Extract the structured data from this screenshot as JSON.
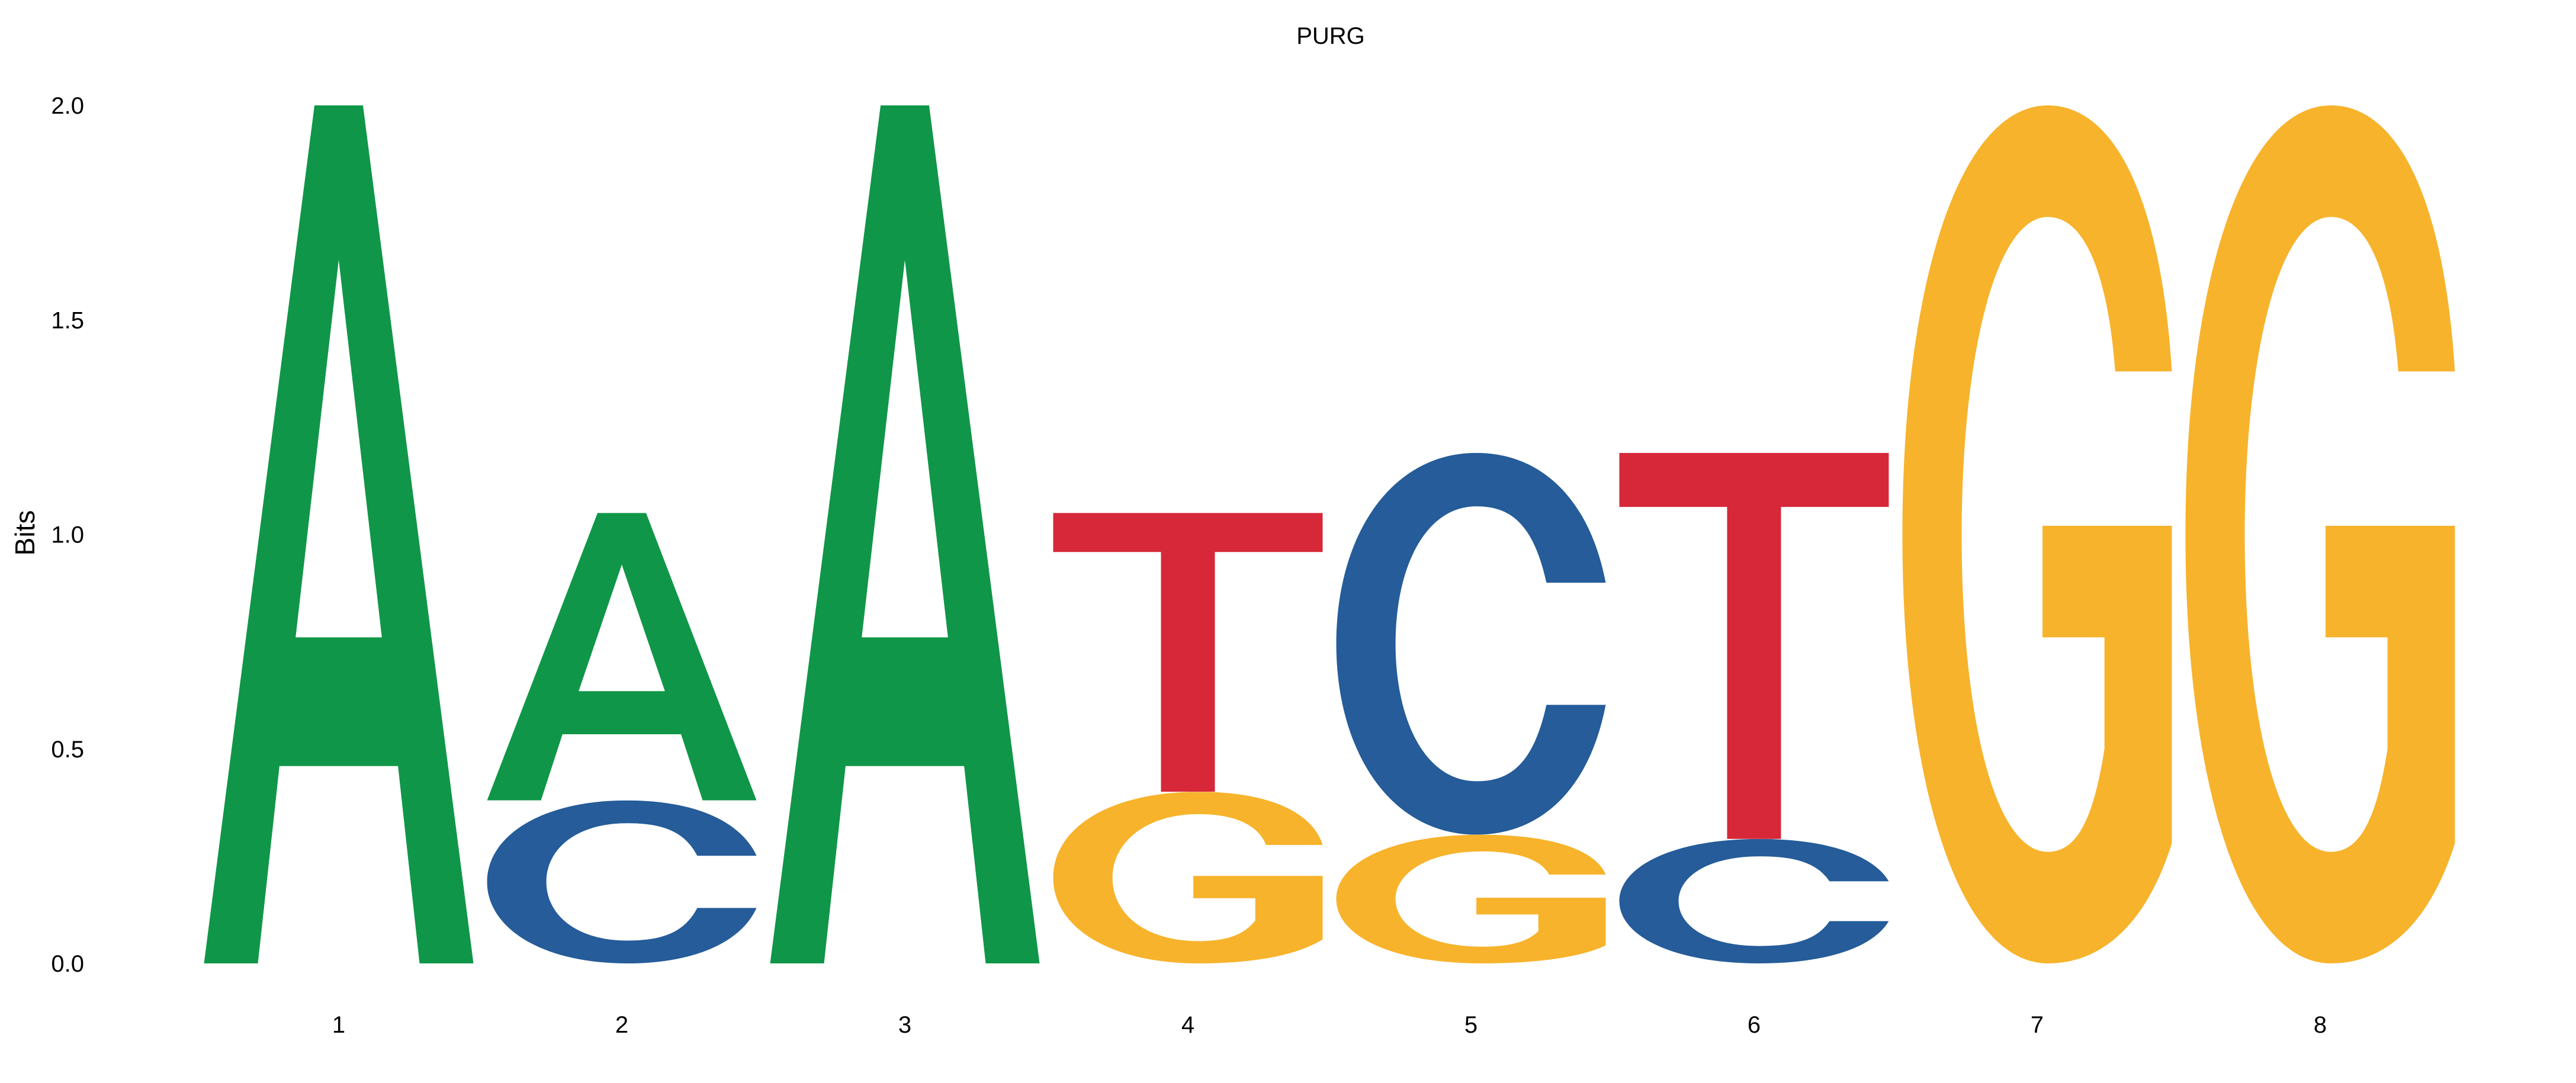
{
  "chart_data": {
    "type": "sequence-logo",
    "title": "PURG",
    "ylabel": "Bits",
    "xlabel": "",
    "ylim": [
      0,
      2.0
    ],
    "yticks": [
      "0.0",
      "0.5",
      "1.0",
      "1.5",
      "2.0"
    ],
    "ytick_values": [
      0.0,
      0.5,
      1.0,
      1.5,
      2.0
    ],
    "grid": false,
    "legend": "none",
    "colors": {
      "A": "#109648",
      "C": "#255C99",
      "G": "#F7B32B",
      "T": "#D62839"
    },
    "positions": [
      {
        "label": "1",
        "letters": [
          {
            "base": "A",
            "height": 2.0
          }
        ]
      },
      {
        "label": "2",
        "letters": [
          {
            "base": "C",
            "height": 0.38
          },
          {
            "base": "A",
            "height": 0.67
          }
        ]
      },
      {
        "label": "3",
        "letters": [
          {
            "base": "A",
            "height": 2.0
          }
        ]
      },
      {
        "label": "4",
        "letters": [
          {
            "base": "G",
            "height": 0.4
          },
          {
            "base": "T",
            "height": 0.65
          }
        ]
      },
      {
        "label": "5",
        "letters": [
          {
            "base": "G",
            "height": 0.3
          },
          {
            "base": "C",
            "height": 0.89
          }
        ]
      },
      {
        "label": "6",
        "letters": [
          {
            "base": "C",
            "height": 0.29
          },
          {
            "base": "T",
            "height": 0.9
          }
        ]
      },
      {
        "label": "7",
        "letters": [
          {
            "base": "G",
            "height": 2.0
          }
        ]
      },
      {
        "label": "8",
        "letters": [
          {
            "base": "G",
            "height": 2.0
          }
        ]
      }
    ]
  }
}
